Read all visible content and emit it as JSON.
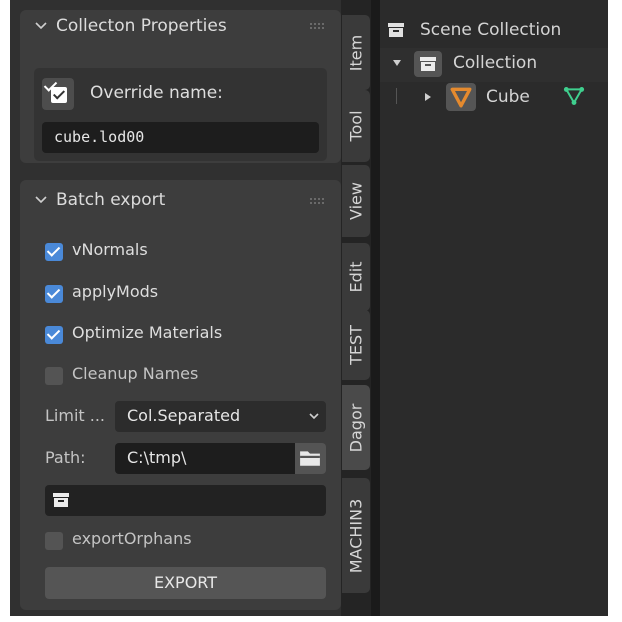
{
  "properties_panel": {
    "title": "Collecton Properties",
    "override_label": "Override name:",
    "override_checked": true,
    "name_value": "cube.lod00"
  },
  "batch_panel": {
    "title": "Batch export",
    "options": [
      {
        "label": "vNormals",
        "checked": true
      },
      {
        "label": "applyMods",
        "checked": true
      },
      {
        "label": "Optimize Materials",
        "checked": true
      },
      {
        "label": "Cleanup Names",
        "checked": false
      }
    ],
    "limit_label": "Limit ...",
    "limit_value": "Col.Separated",
    "path_label": "Path:",
    "path_value": "C:\\tmp\\",
    "collection_value": "",
    "export_orphans_label": "exportOrphans",
    "export_orphans_checked": false,
    "export_button": "EXPORT"
  },
  "tabs": [
    "Item",
    "Tool",
    "View",
    "Edit",
    "TEST",
    "Dagor",
    "MACHIN3"
  ],
  "active_tab": "Dagor",
  "outliner": {
    "scene": "Scene Collection",
    "collection": "Collection",
    "object": "Cube"
  },
  "colors": {
    "accent": "#4a89d8",
    "object_icon": "#e58a2e",
    "mesh_icon": "#3fcf8e"
  }
}
